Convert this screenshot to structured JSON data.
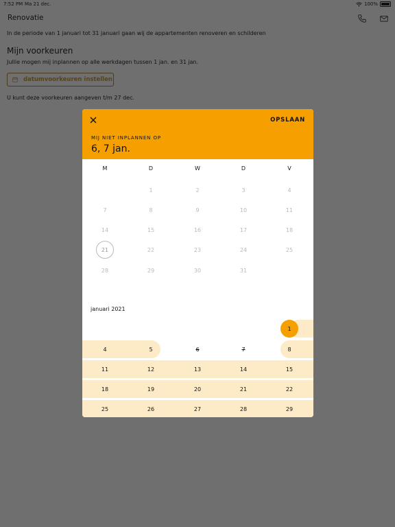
{
  "status_bar": {
    "time": "7:52 PM",
    "date": "Ma 21 dec.",
    "battery": "100%"
  },
  "header": {
    "title": "Renovatie"
  },
  "intro_text": "In de periode van 1 januari tot 31 januari gaan wij de appartementen renoveren en schilderen",
  "preferences": {
    "title": "Mijn voorkeuren",
    "subtitle": "Jullie mogen mij inplannen op alle werkdagen tussen 1 jan. en 31 jan.",
    "button_label": "datumvoorkeuren instellen",
    "deadline_text": "U kunt deze voorkeuren aangeven t/m 27 dec."
  },
  "modal": {
    "save_label": "OPSLAAN",
    "header_label": "MIJ NIET INPLANNEN OP",
    "header_value": "6, 7 jan.",
    "weekdays": [
      "M",
      "D",
      "W",
      "D",
      "V"
    ],
    "dec_rows": [
      [
        "",
        "1",
        "2",
        "3",
        "4"
      ],
      [
        "7",
        "8",
        "9",
        "10",
        "11"
      ],
      [
        "14",
        "15",
        "16",
        "17",
        "18"
      ],
      [
        "21",
        "22",
        "23",
        "24",
        "25"
      ],
      [
        "28",
        "29",
        "30",
        "31",
        ""
      ]
    ],
    "month_label": "januari 2021",
    "jan_rows": [
      [
        "",
        "",
        "",
        "",
        "1"
      ],
      [
        "4",
        "5",
        "6",
        "7",
        "8"
      ],
      [
        "11",
        "12",
        "13",
        "14",
        "15"
      ],
      [
        "18",
        "19",
        "20",
        "21",
        "22"
      ],
      [
        "25",
        "26",
        "27",
        "28",
        "29"
      ]
    ]
  },
  "colors": {
    "accent": "#f5a000",
    "highlight": "#fdebc8",
    "backdrop": "#6f6f6f"
  }
}
